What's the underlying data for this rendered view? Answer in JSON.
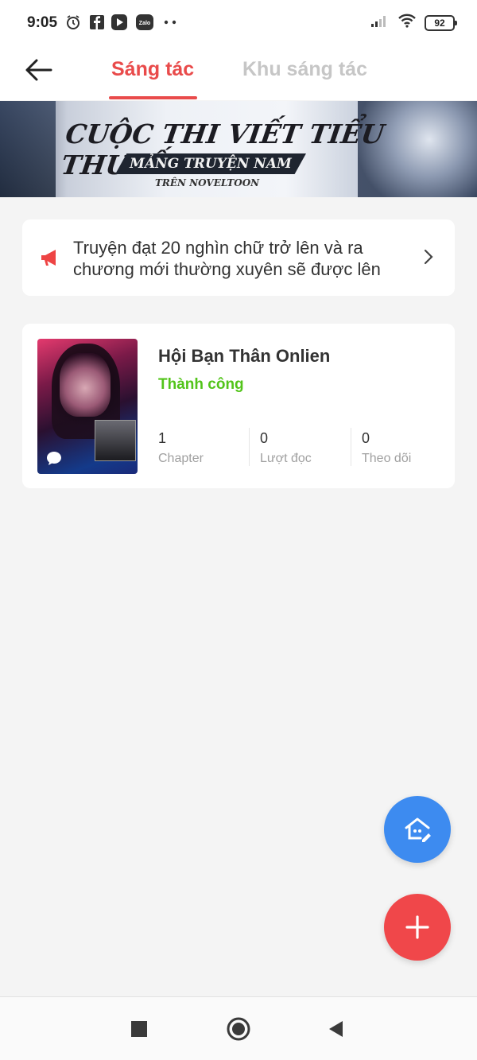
{
  "status_bar": {
    "time": "9:05",
    "battery": "92",
    "icons": [
      "alarm-icon",
      "facebook-icon",
      "play-icon",
      "zalo-icon",
      "more-dots-icon",
      "signal-icon",
      "wifi-icon",
      "battery-icon"
    ]
  },
  "header": {
    "tabs": [
      {
        "label": "Sáng tác",
        "active": true
      },
      {
        "label": "Khu sáng tác",
        "active": false
      }
    ],
    "accent_color": "#e94b4b"
  },
  "banner": {
    "title": "CUỘC THI VIẾT TIỂU THUYẾT",
    "subtitle": "MẢNG TRUYỆN NAM",
    "caption": "TRÊN NOVELTOON"
  },
  "notice": {
    "text": "Truyện đạt 20 nghìn chữ trở lên và ra chương mới thường xuyên sẽ được lên"
  },
  "story": {
    "title": "Hội Bạn Thân Onlien",
    "status": "Thành công",
    "status_color": "#52c41a",
    "stats": [
      {
        "value": "1",
        "label": "Chapter"
      },
      {
        "value": "0",
        "label": "Lượt đọc"
      },
      {
        "value": "0",
        "label": "Theo dõi"
      }
    ]
  },
  "fabs": {
    "home_color": "#3d8bf0",
    "add_color": "#f0474a"
  }
}
